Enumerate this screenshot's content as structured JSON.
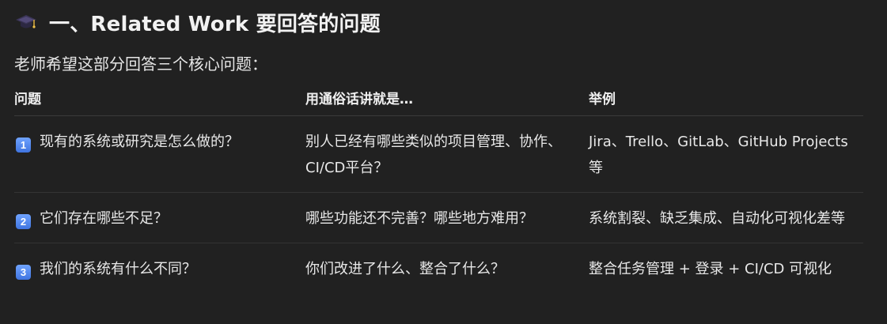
{
  "heading": {
    "icon": "graduation-cap-icon",
    "title": "一、Related Work 要回答的问题"
  },
  "intro": "老师希望这部分回答三个核心问题：",
  "table": {
    "headers": [
      "问题",
      "用通俗话讲就是…",
      "举例"
    ],
    "rows": [
      {
        "num": "1",
        "question": "现有的系统或研究是怎么做的？",
        "plain": "别人已经有哪些类似的项目管理、协作、CI/CD平台？",
        "example": "Jira、Trello、GitLab、GitHub Projects 等"
      },
      {
        "num": "2",
        "question": "它们存在哪些不足？",
        "plain": "哪些功能还不完善？哪些地方难用？",
        "example": "系统割裂、缺乏集成、自动化可视化差等"
      },
      {
        "num": "3",
        "question": "我们的系统有什么不同？",
        "plain": "你们改进了什么、整合了什么？",
        "example": "整合任务管理 + 登录 + CI/CD 可视化"
      }
    ]
  },
  "colors": {
    "background": "#212121",
    "text": "#ececec",
    "badge": "#4f86f0"
  }
}
